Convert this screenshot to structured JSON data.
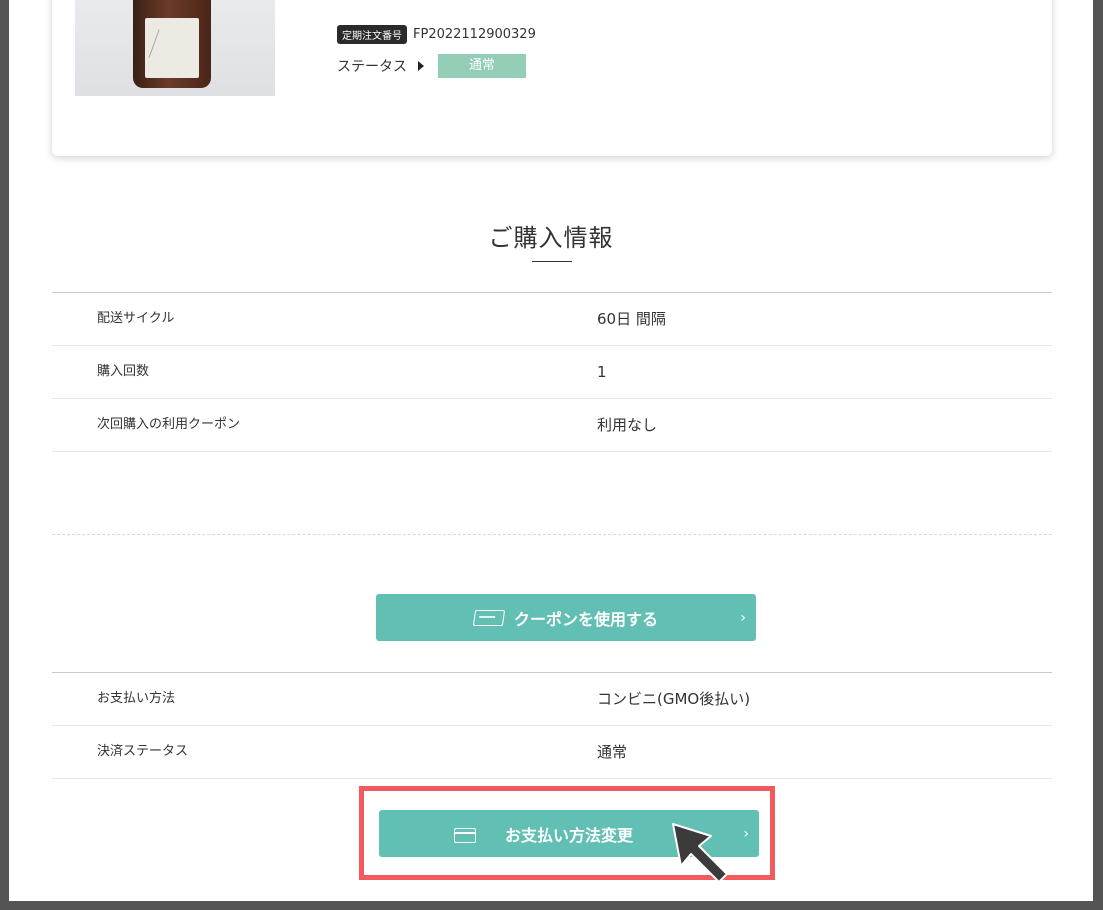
{
  "product": {
    "order_badge": "定期注文番号",
    "order_number": "FP2022112900329",
    "status_label": "ステータス",
    "status_value": "通常"
  },
  "purchase_info": {
    "title": "ご購入情報",
    "rows": [
      {
        "label": "配送サイクル",
        "value": "60日 間隔"
      },
      {
        "label": "購入回数",
        "value": "1"
      },
      {
        "label": "次回購入の利用クーポン",
        "value": "利用なし"
      }
    ]
  },
  "coupon_button": {
    "label": "クーポンを使用する"
  },
  "payment_info": {
    "rows": [
      {
        "label": "お支払い方法",
        "value": "コンビニ(GMO後払い)"
      },
      {
        "label": "決済ステータス",
        "value": "通常"
      }
    ]
  },
  "payment_change_button": {
    "label": "お支払い方法変更"
  },
  "colors": {
    "accent": "#62bfb4",
    "status_badge": "#93cdb5",
    "highlight": "#f25a5d"
  },
  "icons": [
    "coupon-icon",
    "credit-card-icon",
    "chevron-right-icon",
    "triangle-right-icon",
    "mouse-cursor-icon"
  ]
}
